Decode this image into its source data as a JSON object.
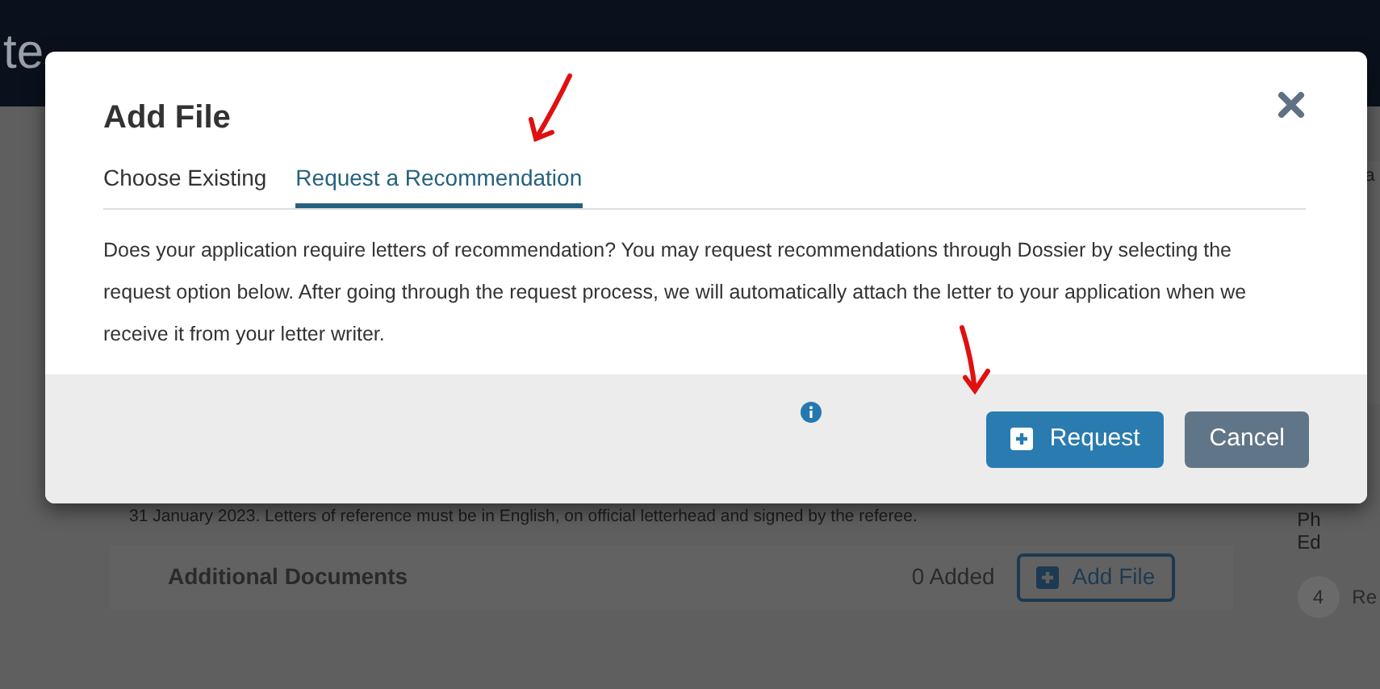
{
  "header": {
    "logo": "te"
  },
  "page": {
    "notice": "31 January 2023. Letters of reference must be in English, on official letterhead and signed by the referee.",
    "section": {
      "title": "Additional Documents",
      "count": "0 Added",
      "button": "Add File"
    },
    "sidebar": {
      "fragments": [
        "a",
        "Ph",
        "Ed"
      ],
      "step": {
        "number": "4",
        "label": "Re"
      }
    }
  },
  "dialog": {
    "title": "Add File",
    "tabs": [
      {
        "label": "Choose Existing",
        "selected": false
      },
      {
        "label": "Request a Recommendation",
        "selected": true
      }
    ],
    "body": "Does your application require letters of recommendation? You may request recommendations through Dossier by selecting the request option below. After going through the request process, we will automatically attach the letter to your application when we receive it from your letter writer.",
    "buttons": [
      {
        "kind": "primary",
        "label": "Request"
      },
      {
        "kind": "secondary",
        "label": "Cancel"
      }
    ]
  }
}
